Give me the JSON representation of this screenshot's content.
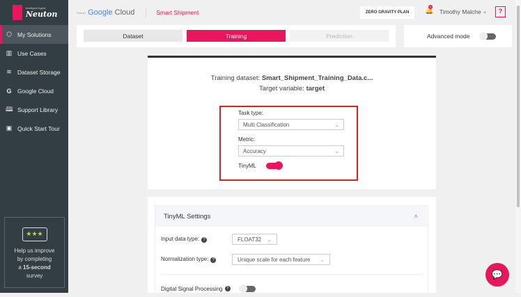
{
  "brand": {
    "tagline": "Intelligent Agent",
    "name": "Neuton"
  },
  "header": {
    "partner": "Partner",
    "google": "Google",
    "cloud": "Cloud",
    "title": "Smart Shipment",
    "plan": "ZERO GRAVITY PLAN",
    "notifications": "4",
    "user": "Timothy Malche",
    "help": "?"
  },
  "sidebar": {
    "items": [
      {
        "label": "My Solutions",
        "icon": "cube-icon"
      },
      {
        "label": "Use Cases",
        "icon": "briefcase-icon"
      },
      {
        "label": "Dataset Storage",
        "icon": "layers-icon"
      },
      {
        "label": "Google Cloud",
        "icon": "google-icon"
      },
      {
        "label": "Support Library",
        "icon": "book-icon"
      },
      {
        "label": "Quick Start Tour",
        "icon": "play-screen-icon"
      }
    ],
    "survey": {
      "line1": "Help us improve",
      "line2": "by completing",
      "pre": "a ",
      "bold": "15-second",
      "line4": "survey"
    }
  },
  "tabs": [
    "Dataset",
    "Training",
    "Prediction"
  ],
  "advanced_mode": {
    "label": "Advanced mode",
    "on": false
  },
  "training": {
    "dataset_label": "Training dataset:",
    "dataset_value": "Smart_Shipment_Training_Data.c...",
    "target_label": "Target variable:",
    "target_value": "target",
    "task_type_label": "Task type:",
    "task_type": "Multi Classification",
    "metric_label": "Metric:",
    "metric": "Accuracy",
    "tinyml_label": "TinyML",
    "tinyml_on": true
  },
  "tinyml_settings": {
    "title": "TinyML Settings",
    "input_label": "Input data type:",
    "input_value": "FLOAT32",
    "norm_label": "Normalization type:",
    "norm_value": "Unique scale for each feature",
    "dsp_label": "Digital Signal Processing",
    "dsp_on": false
  },
  "colors": {
    "accent": "#e8175d",
    "sidebar": "#323d44",
    "highlight": "#e02020"
  }
}
